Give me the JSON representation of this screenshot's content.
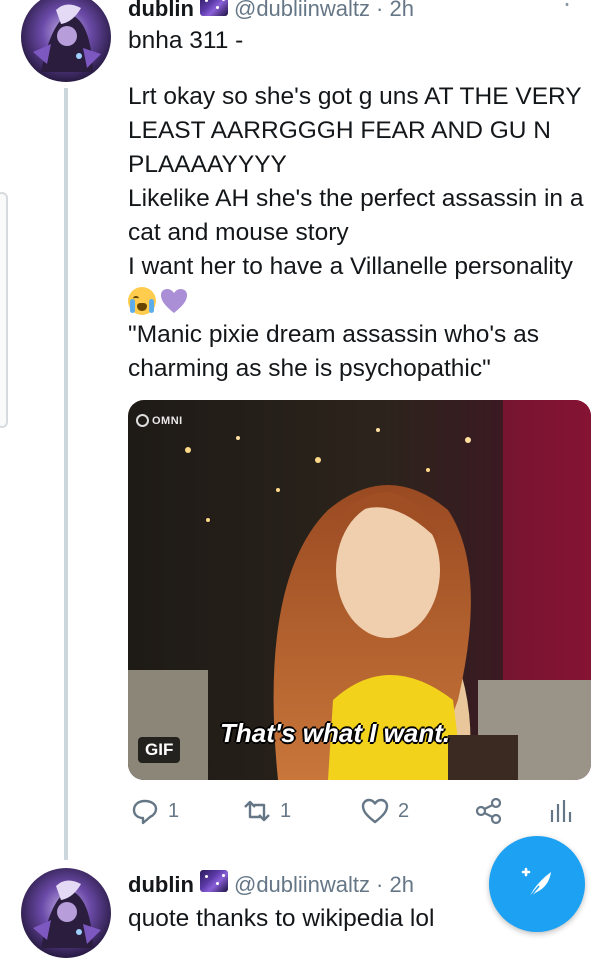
{
  "tweet1": {
    "name": "dublin",
    "handle": "@dubliinwaltz",
    "time": "· 2h",
    "reply_to": "bnha 311 -",
    "lines": [
      "Lrt okay so she's got g uns AT THE VERY LEAST AARRGGGH FEAR AND GU N PLAAAAYYYY",
      "Likelike AH she's the perfect assassin in a cat and mouse story",
      "I want her to have a Villanelle personality"
    ],
    "emojis": [
      "crying-face-emoji",
      "purple-heart-emoji"
    ],
    "quote": "\"Manic pixie dream assassin who's as charming as she is psychopathic\"",
    "media": {
      "watermark": "OMNI",
      "caption": "That's what I want.",
      "badge": "GIF"
    },
    "stats": {
      "replies": "1",
      "retweets": "1",
      "likes": "2"
    }
  },
  "tweet2": {
    "name": "dublin",
    "handle": "@dubliinwaltz",
    "time": "· 2h",
    "text": "quote thanks to wikipedia lol"
  },
  "icons": {
    "reply": "reply-icon",
    "retweet": "retweet-icon",
    "like": "heart-icon",
    "share": "share-icon",
    "analytics": "analytics-icon",
    "compose": "compose-tweet-icon",
    "more": "more-options-icon"
  },
  "colors": {
    "accent": "#1da1f2",
    "muted": "#657786",
    "line": "#ccd6dd"
  }
}
